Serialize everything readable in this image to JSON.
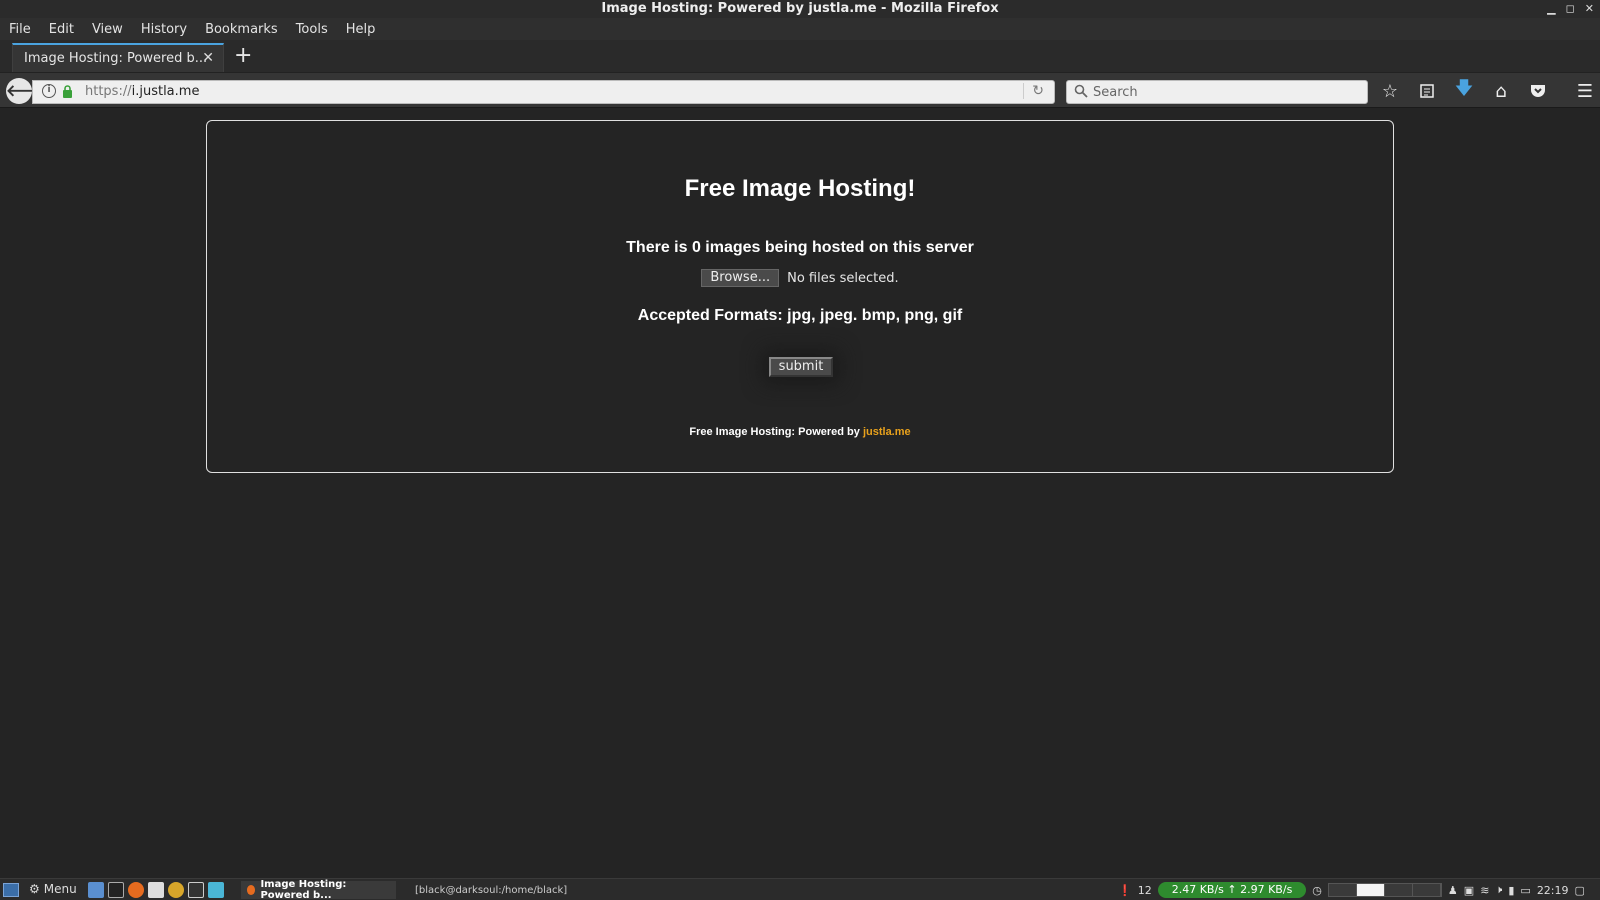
{
  "window": {
    "title": "Image Hosting: Powered by justla.me - Mozilla Firefox"
  },
  "menubar": {
    "items": [
      "File",
      "Edit",
      "View",
      "History",
      "Bookmarks",
      "Tools",
      "Help"
    ]
  },
  "tabs": [
    {
      "label": "Image Hosting: Powered b..."
    }
  ],
  "navbar": {
    "url_scheme": "https://",
    "url_host": "i.justla.me",
    "search_placeholder": "Search"
  },
  "page": {
    "title": "Free Image Hosting!",
    "count_text": "There is 0 images being hosted on this server",
    "browse_label": "Browse...",
    "file_status": "No files selected.",
    "formats_text": "Accepted Formats: jpg, jpeg. bmp, png, gif",
    "submit_label": "submit",
    "footer_prefix": "Free Image Hosting: Powered by ",
    "footer_link": "justla.me",
    "link_color": "#e8a11c"
  },
  "taskbar": {
    "menu_label": "Menu",
    "tasks": [
      {
        "label": "Image Hosting: Powered b..."
      },
      {
        "label": "[black@darksoul:/home/black]"
      }
    ],
    "tray": {
      "updates_count": "12",
      "net_down": "2.47 KB/s",
      "net_up": "2.97 KB/s",
      "clock": "22:19"
    }
  }
}
